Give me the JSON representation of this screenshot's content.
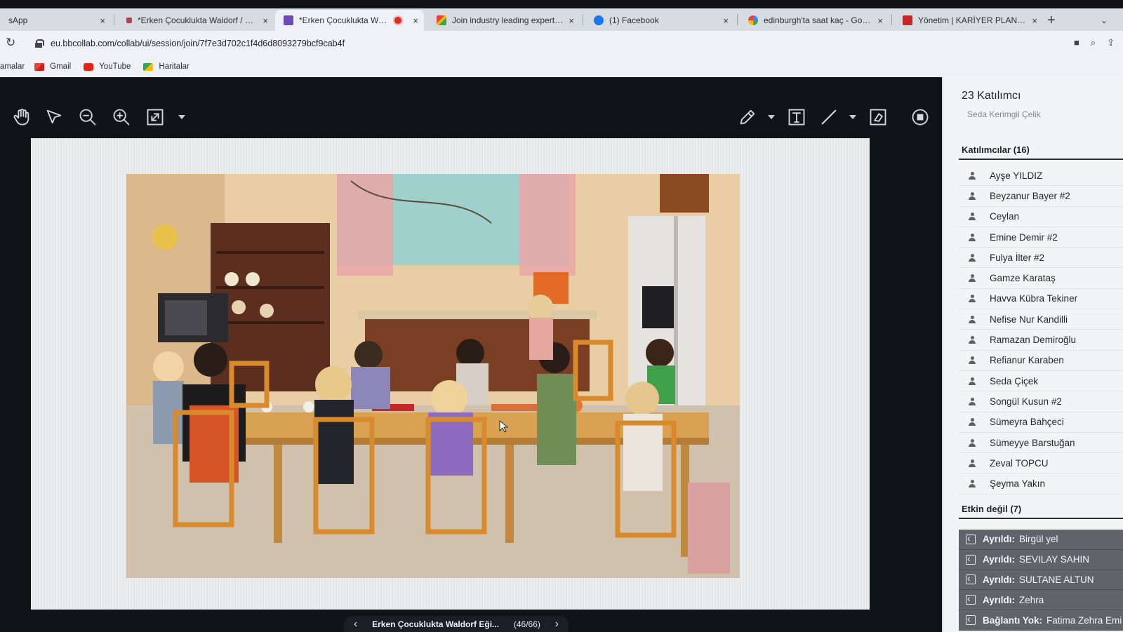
{
  "browser": {
    "tabs": [
      {
        "label": "sApp",
        "favicon": "whatsapp-icon"
      },
      {
        "label": "*Erken Çocuklukta Waldorf / Ste",
        "favicon": "document-icon"
      },
      {
        "label": "*Erken Çocuklukta Waldorf",
        "favicon": "collaborate-icon",
        "active": true,
        "recording": true
      },
      {
        "label": "Join industry leading experts fr",
        "favicon": "gmail-icon"
      },
      {
        "label": "(1) Facebook",
        "favicon": "facebook-icon"
      },
      {
        "label": "edinburgh'ta saat kaç - Google",
        "favicon": "google-icon"
      },
      {
        "label": "Yönetim | KARİYER PLANLAMA",
        "favicon": "career-icon"
      }
    ],
    "new_tab": "+",
    "close_glyph": "×",
    "url": "eu.bbcollab.com/collab/ui/session/join/7f7e3d702c1f4d6d8093279bcf9cab4f",
    "bookmarks": [
      {
        "label": "amalar",
        "icon": "apps-icon"
      },
      {
        "label": "Gmail",
        "icon": "gmail-icon"
      },
      {
        "label": "YouTube",
        "icon": "youtube-icon"
      },
      {
        "label": "Haritalar",
        "icon": "maps-icon"
      }
    ]
  },
  "viewer": {
    "tools": [
      "pan-hand-icon",
      "pointer-icon",
      "zoom-out-icon",
      "zoom-in-icon",
      "fit-screen-icon",
      "pencil-icon",
      "text-tool-icon",
      "line-tool-icon",
      "eraser-icon",
      "stop-share-icon"
    ],
    "pager": {
      "prev": "‹",
      "title": "Erken Çocuklukta Waldorf Eği...",
      "position": "(46/66)",
      "next": "›"
    }
  },
  "participants_panel": {
    "title": "23 Katılımcı",
    "cut_off_name": "Seda Kerimgil Çelik",
    "active_header": "Katılımcılar (16)",
    "active": [
      "Ayşe YILDIZ",
      "Beyzanur Bayer #2",
      "Ceylan",
      "Emine Demir #2",
      "Fulya İlter #2",
      "Gamze Karataş",
      "Havva Kübra Tekiner",
      "Nefise Nur Kandilli",
      "Ramazan Demiroğlu",
      "Refianur Karaben",
      "Seda Çiçek",
      "Songül Kusun #2",
      "Sümeyra Bahçeci",
      "Sümeyye Barstuğan",
      "Zeval TOPCU",
      "Şeyma Yakın"
    ],
    "inactive_header": "Etkin değil (7)",
    "inactive": [
      {
        "status": "Ayrıldı:",
        "name": "Birgül yel"
      },
      {
        "status": "Ayrıldı:",
        "name": "SEVILAY SAHIN"
      },
      {
        "status": "Ayrıldı:",
        "name": "SULTANE ALTUN"
      },
      {
        "status": "Ayrıldı:",
        "name": "Zehra"
      },
      {
        "status": "Bağlantı Yok:",
        "name": "Fatima Zehra Emi"
      }
    ]
  },
  "colors": {
    "viewer_bg": "#101318",
    "panel_bg": "#f3f4f6",
    "inactive_row": "#5f646b",
    "recording": "#d93025"
  }
}
